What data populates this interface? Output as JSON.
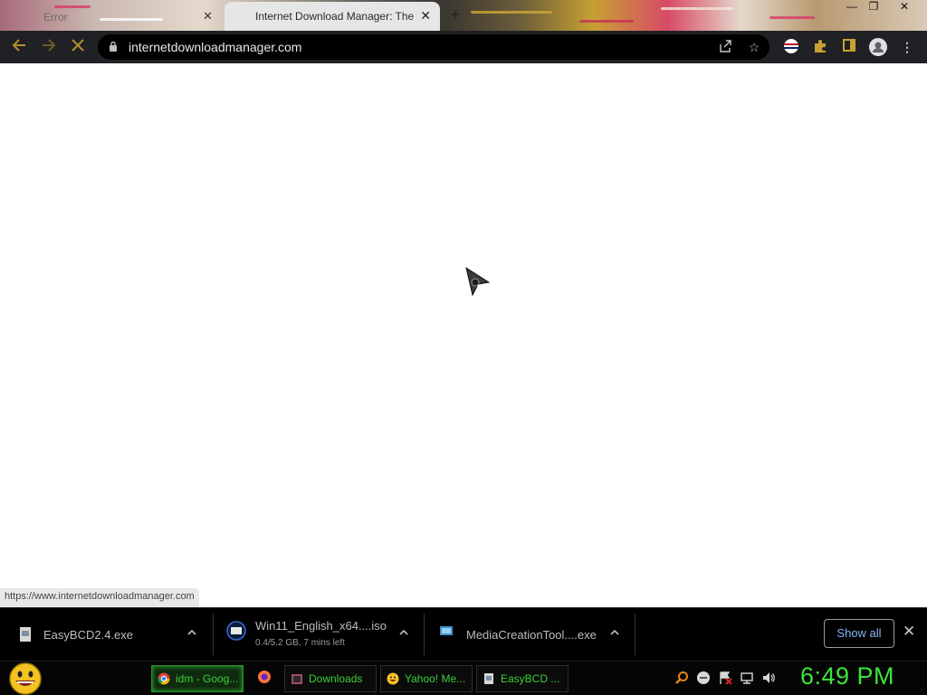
{
  "browser": {
    "tabs": [
      {
        "label": "Error",
        "active": false
      },
      {
        "label": "Internet Download Manager: The",
        "active": true
      }
    ],
    "url": "internetdownloadmanager.com",
    "status_url": "https://www.internetdownloadmanager.com"
  },
  "downloads": {
    "items": [
      {
        "name": "EasyBCD2.4.exe",
        "status": ""
      },
      {
        "name": "Win11_English_x64....iso",
        "status": "0.4/5.2 GB, 7 mins left"
      },
      {
        "name": "MediaCreationTool....exe",
        "status": ""
      }
    ],
    "show_all_label": "Show all"
  },
  "taskbar": {
    "buttons": [
      {
        "label": "idm - Goog..."
      },
      {
        "label": "Downloads"
      },
      {
        "label": "Yahoo! Me..."
      },
      {
        "label": "EasyBCD ..."
      }
    ],
    "clock": "6:49 PM"
  },
  "colors": {
    "toolbar_bg": "#202124",
    "accent_gold": "#b28f2e",
    "taskbar_text": "#3ad13a",
    "show_all_text": "#8ab4f8"
  }
}
